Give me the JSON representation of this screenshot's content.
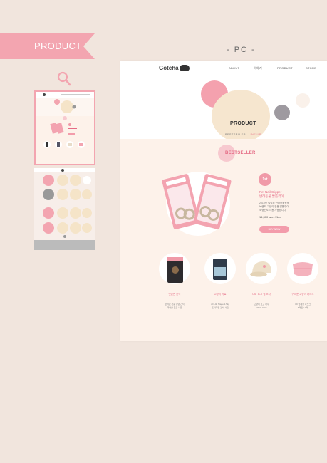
{
  "section_label": "PRODUCT",
  "pc_label": "- PC -",
  "site": {
    "logo_text": "Gotcha",
    "nav": [
      "ABOUT",
      "이야기",
      "PRODUCT",
      "STORE"
    ]
  },
  "hero": {
    "title": "PRODUCT",
    "sub_prefix": "BESTSELLER",
    "sub_suffix": "LINE UP"
  },
  "bestseller": {
    "title": "BESTSELLER",
    "badge": "1st",
    "name_en": "Pet Nail Clipper",
    "name_kr": "반려동물 발톱깎이",
    "desc": [
      "2010년 설립된 반려동물용품",
      "브랜드 고양이 전용 발톱깎이",
      "소형견도 사용 가능합니다"
    ],
    "price": "14,300 won / 1ea",
    "button": "BUY NOW"
  },
  "products": [
    {
      "name": "맛있는 간식",
      "sub": "반려묘 전용 영양 간식",
      "sub2": "국내산 원료 사용"
    },
    {
      "name": "고양이 사료",
      "sub": "All Life Stage 1.5kg",
      "sub2": "프리미엄 건식 사료"
    },
    {
      "name": "CAT 로고 캡 모자",
      "sub": "고양이 로고 자수",
      "sub2": "FREE SIZE"
    },
    {
      "name": "귀여운 고양이 마스크",
      "sub": "3D 입체형 마스크",
      "sub2": "5매입 / 1팩"
    }
  ],
  "colors": {
    "accent": "#f3a5b0",
    "pink": "#e56b85",
    "background": "#f1e5dd"
  }
}
